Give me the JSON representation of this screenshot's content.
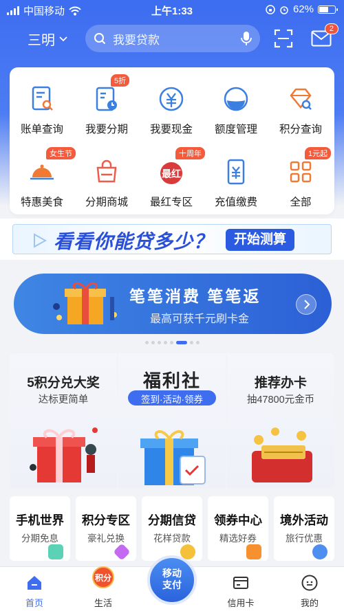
{
  "status_bar": {
    "carrier": "中国移动",
    "time": "上午1:33",
    "battery": "62%",
    "battery_level": 0.62
  },
  "header": {
    "city": "三明",
    "search_placeholder": "我要贷款",
    "mail_badge": "2"
  },
  "grid": [
    {
      "label": "账单查询",
      "icon": "bill-search-icon"
    },
    {
      "label": "我要分期",
      "icon": "installment-icon",
      "tag": "5折"
    },
    {
      "label": "我要现金",
      "icon": "yuan-cash-icon"
    },
    {
      "label": "额度管理",
      "icon": "credit-limit-icon"
    },
    {
      "label": "积分查询",
      "icon": "points-diamond-icon"
    },
    {
      "label": "特惠美食",
      "icon": "food-dish-icon",
      "tag": "女生节"
    },
    {
      "label": "分期商城",
      "icon": "shopping-bag-icon"
    },
    {
      "label": "最红专区",
      "icon": "zuihong-icon",
      "tag": "十周年",
      "icon_text": "最红"
    },
    {
      "label": "充值缴费",
      "icon": "recharge-icon"
    },
    {
      "label": "全部",
      "icon": "all-grid-icon",
      "tag": "1元起"
    }
  ],
  "calc_banner": {
    "title": "看看你能贷多少？",
    "button": "开始测算"
  },
  "promo_banner": {
    "title": "笔笔消费 笔笔返",
    "subtitle": "最高可获千元刷卡金"
  },
  "carousel": {
    "count": 8,
    "active": 5
  },
  "features": [
    {
      "title": "5积分兑大奖",
      "subtitle": "达标更简单"
    },
    {
      "title": "福利社",
      "subtitle": "签到·活动·领券"
    },
    {
      "title": "推荐办卡",
      "subtitle": "抽47800元金币"
    }
  ],
  "quick_cards": [
    {
      "title": "手机世界",
      "subtitle": "分期免息"
    },
    {
      "title": "积分专区",
      "subtitle": "豪礼兑换"
    },
    {
      "title": "分期信贷",
      "subtitle": "花样贷款"
    },
    {
      "title": "领券中心",
      "subtitle": "精选好券"
    },
    {
      "title": "境外活动",
      "subtitle": "旅行优惠"
    }
  ],
  "tabbar": {
    "tabs": [
      {
        "label": "首页",
        "icon": "home-icon"
      },
      {
        "label": "生活",
        "icon": "points-life-icon",
        "icon_text": "积分"
      },
      {
        "label": "信用卡",
        "icon": "credit-card-icon"
      },
      {
        "label": "我的",
        "icon": "profile-face-icon"
      }
    ],
    "center_button": "移动\n支付"
  },
  "colors": {
    "brand_blue": "#3d6df0",
    "accent_red": "#f45b3c",
    "icon_blue": "#3b7fe0",
    "icon_orange": "#f07a34"
  }
}
